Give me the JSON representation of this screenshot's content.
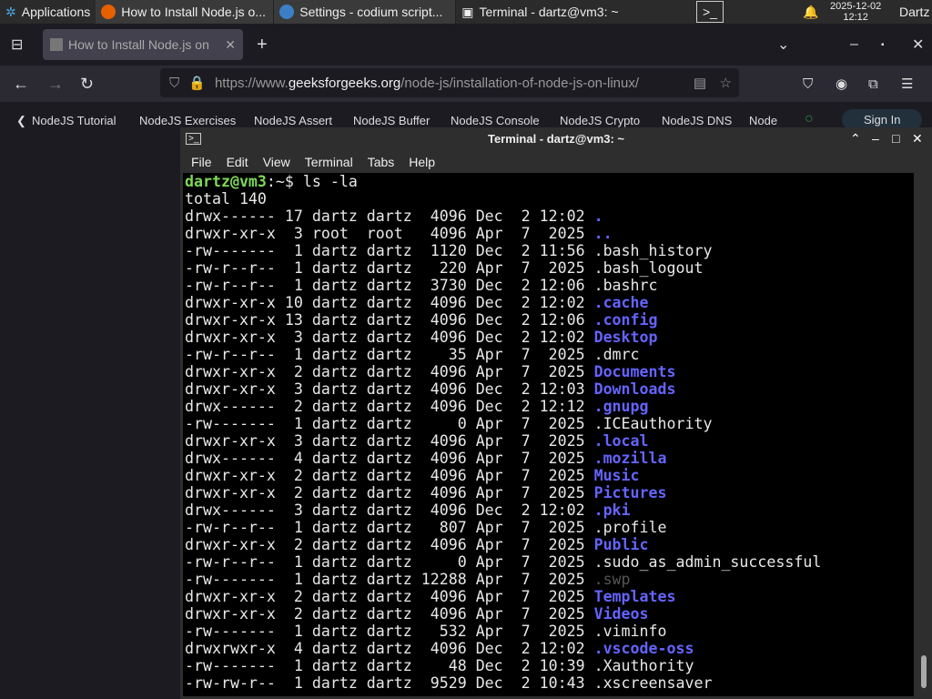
{
  "taskbar": {
    "apps": "Applications",
    "windows": [
      "How to Install Node.js o...",
      "Settings - codium script...",
      "Terminal - dartz@vm3: ~"
    ],
    "date": "2025-12-02",
    "time": "12:12",
    "user": "Dartz"
  },
  "browser": {
    "tab": "How to Install Node.js on",
    "url_prefix": "https://www.",
    "url_domain": "geeksforgeeks.org",
    "url_path": "/node-js/installation-of-node-js-on-linux/",
    "bookmarks": [
      "NodeJS Tutorial",
      "NodeJS Exercises",
      "NodeJS Assert",
      "NodeJS Buffer",
      "NodeJS Console",
      "NodeJS Crypto",
      "NodeJS DNS",
      "Node"
    ],
    "sign_in": "Sign In"
  },
  "terminal": {
    "title": "Terminal - dartz@vm3: ~",
    "menu": [
      "File",
      "Edit",
      "View",
      "Terminal",
      "Tabs",
      "Help"
    ],
    "prompt": "dartz@vm3",
    "path": ":~$ ",
    "command": "ls -la",
    "total": "total 140",
    "entries": [
      [
        "drwx------ 17 dartz dartz  4096 Dec  2 12:02 ",
        ".",
        "dir"
      ],
      [
        "drwxr-xr-x  3 root  root   4096 Apr  7  2025 ",
        "..",
        "dir"
      ],
      [
        "-rw-------  1 dartz dartz  1120 Dec  2 11:56 ",
        ".bash_history",
        "file"
      ],
      [
        "-rw-r--r--  1 dartz dartz   220 Apr  7  2025 ",
        ".bash_logout",
        "file"
      ],
      [
        "-rw-r--r--  1 dartz dartz  3730 Dec  2 12:06 ",
        ".bashrc",
        "file"
      ],
      [
        "drwxr-xr-x 10 dartz dartz  4096 Dec  2 12:02 ",
        ".cache",
        "dir"
      ],
      [
        "drwxr-xr-x 13 dartz dartz  4096 Dec  2 12:06 ",
        ".config",
        "dir"
      ],
      [
        "drwxr-xr-x  3 dartz dartz  4096 Dec  2 12:02 ",
        "Desktop",
        "dir"
      ],
      [
        "-rw-r--r--  1 dartz dartz    35 Apr  7  2025 ",
        ".dmrc",
        "file"
      ],
      [
        "drwxr-xr-x  2 dartz dartz  4096 Apr  7  2025 ",
        "Documents",
        "dir"
      ],
      [
        "drwxr-xr-x  3 dartz dartz  4096 Dec  2 12:03 ",
        "Downloads",
        "dir"
      ],
      [
        "drwx------  2 dartz dartz  4096 Dec  2 12:12 ",
        ".gnupg",
        "dir"
      ],
      [
        "-rw-------  1 dartz dartz     0 Apr  7  2025 ",
        ".ICEauthority",
        "file"
      ],
      [
        "drwxr-xr-x  3 dartz dartz  4096 Apr  7  2025 ",
        ".local",
        "dir"
      ],
      [
        "drwx------  4 dartz dartz  4096 Apr  7  2025 ",
        ".mozilla",
        "dir"
      ],
      [
        "drwxr-xr-x  2 dartz dartz  4096 Apr  7  2025 ",
        "Music",
        "dir"
      ],
      [
        "drwxr-xr-x  2 dartz dartz  4096 Apr  7  2025 ",
        "Pictures",
        "dir"
      ],
      [
        "drwx------  3 dartz dartz  4096 Dec  2 12:02 ",
        ".pki",
        "dir"
      ],
      [
        "-rw-r--r--  1 dartz dartz   807 Apr  7  2025 ",
        ".profile",
        "file"
      ],
      [
        "drwxr-xr-x  2 dartz dartz  4096 Apr  7  2025 ",
        "Public",
        "dir"
      ],
      [
        "-rw-r--r--  1 dartz dartz     0 Apr  7  2025 ",
        ".sudo_as_admin_successful",
        "file"
      ],
      [
        "-rw-------  1 dartz dartz 12288 Apr  7  2025 ",
        ".swp",
        "dim"
      ],
      [
        "drwxr-xr-x  2 dartz dartz  4096 Apr  7  2025 ",
        "Templates",
        "dir"
      ],
      [
        "drwxr-xr-x  2 dartz dartz  4096 Apr  7  2025 ",
        "Videos",
        "dir"
      ],
      [
        "-rw-------  1 dartz dartz   532 Apr  7  2025 ",
        ".viminfo",
        "file"
      ],
      [
        "drwxrwxr-x  4 dartz dartz  4096 Dec  2 12:02 ",
        ".vscode-oss",
        "dir"
      ],
      [
        "-rw-------  1 dartz dartz    48 Dec  2 10:39 ",
        ".Xauthority",
        "file"
      ],
      [
        "-rw-rw-r--  1 dartz dartz  9529 Dec  2 10:43 ",
        ".xscreensaver",
        "file"
      ]
    ]
  },
  "colors": {
    "prompt": "#7ed957",
    "directory": "#6464ff"
  }
}
